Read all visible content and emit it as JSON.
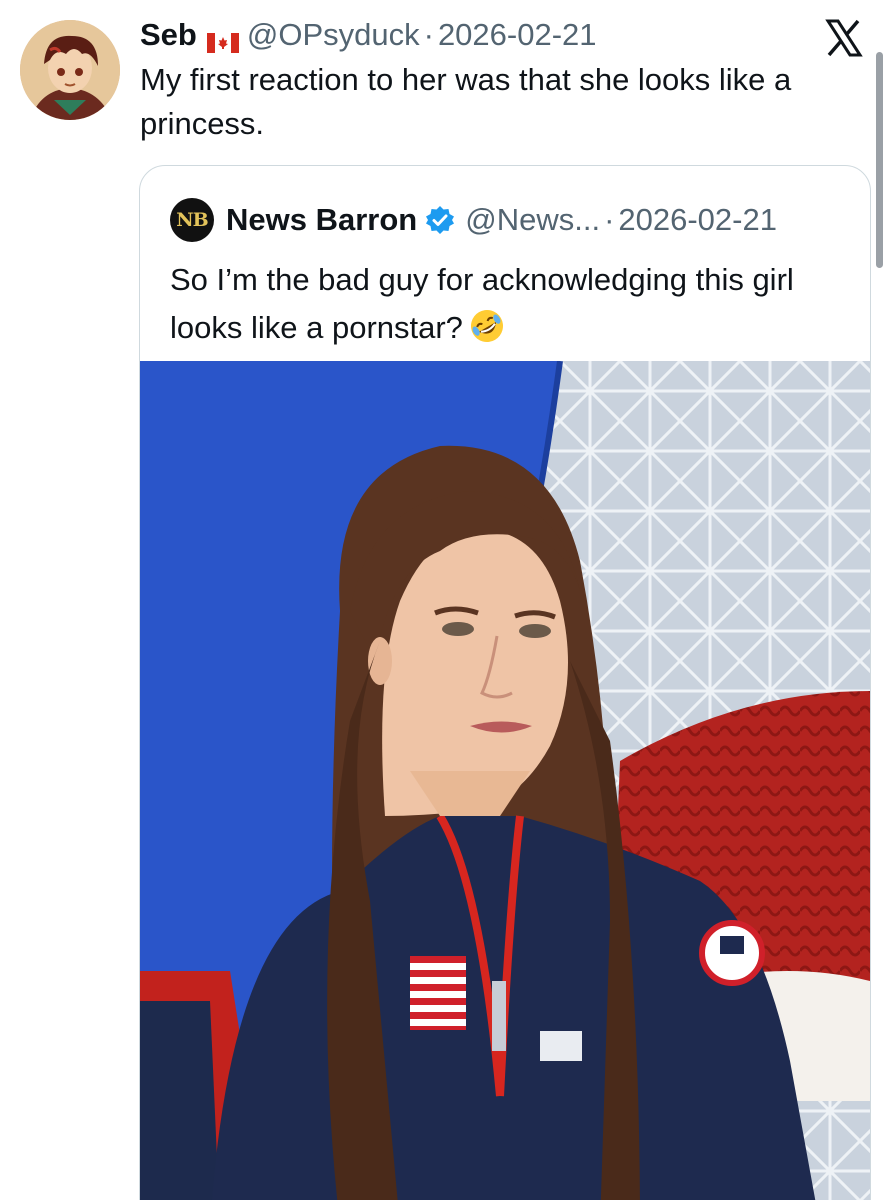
{
  "post": {
    "author": {
      "name": "Seb",
      "flag_icon": "canada-flag-icon",
      "handle": "@OPsyduck",
      "separator": "·",
      "date": "2026-02-21"
    },
    "text": "My first reaction to her was that she looks like a princess.",
    "platform_icon": "x-logo-icon"
  },
  "quoted_post": {
    "author": {
      "avatar_text": "NB",
      "name": "News Barron",
      "verified_icon": "verified-badge-icon",
      "handle": "@News...",
      "separator": "·",
      "date": "2026-02-21"
    },
    "text": "So I’m the bad guy for acknowledging this girl looks like a pornstar?",
    "emoji_icon": "rolling-on-floor-laughing-emoji",
    "media": "photo"
  },
  "colors": {
    "text_primary": "#0f1419",
    "text_secondary": "#536471",
    "verified_blue": "#1d9bf0",
    "card_border": "#cfd9de"
  }
}
